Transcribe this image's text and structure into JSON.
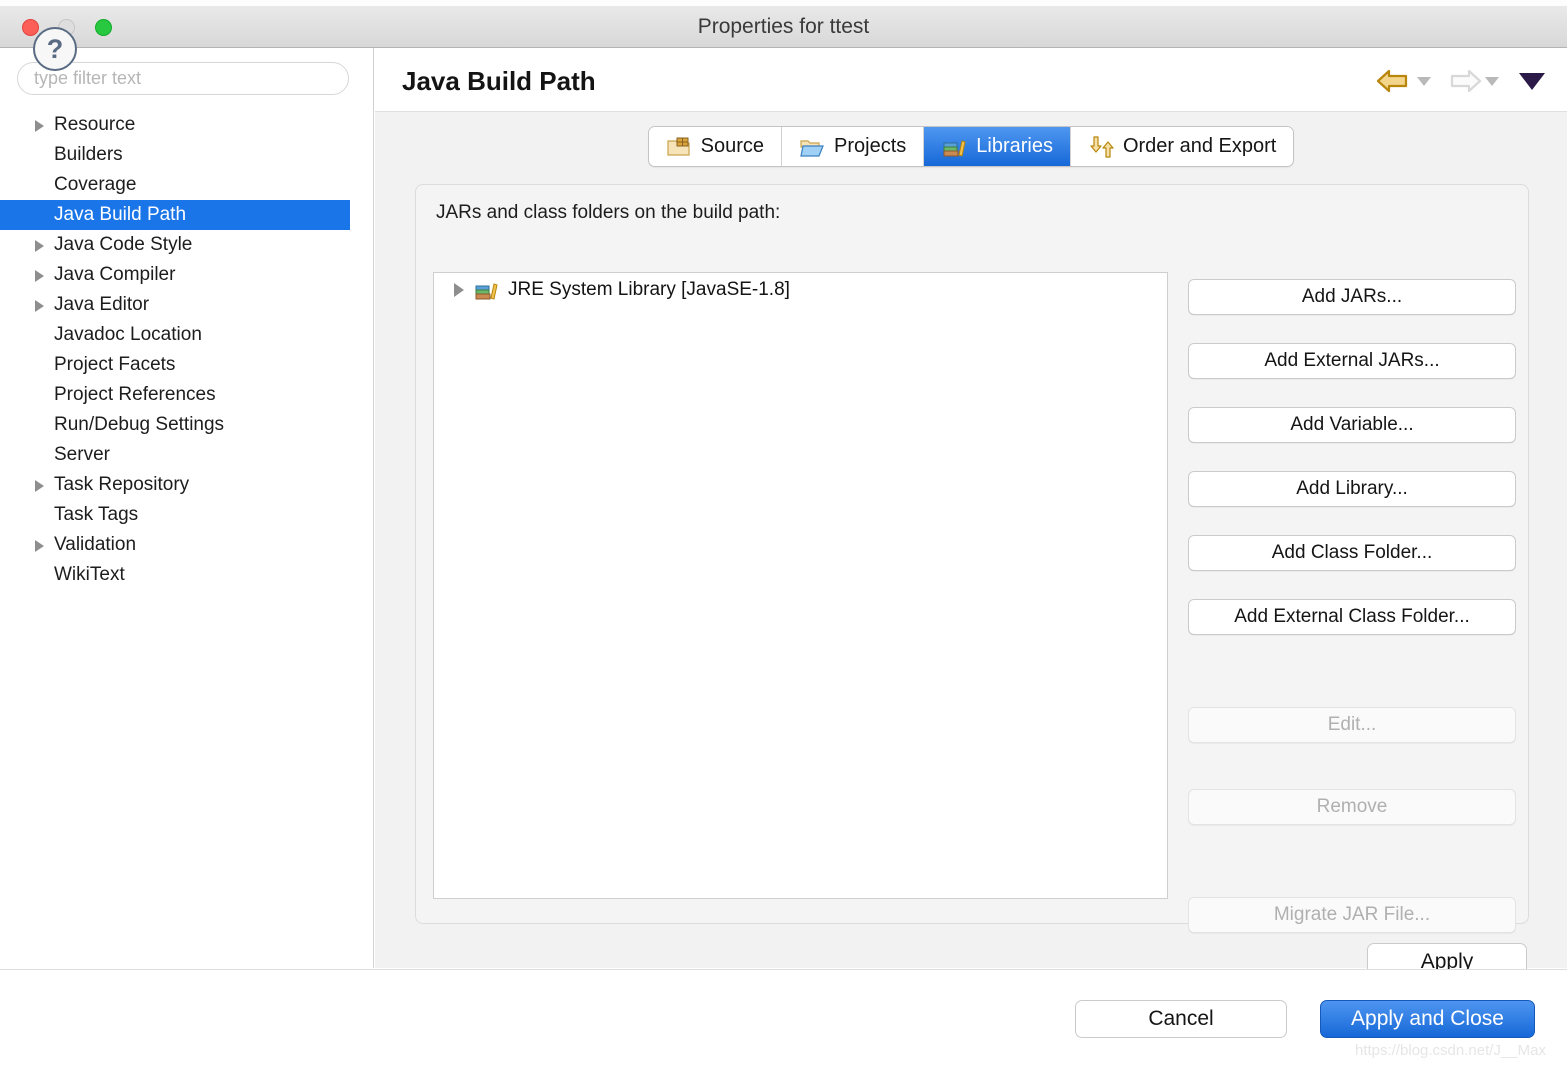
{
  "window": {
    "title": "Properties for ttest",
    "traffic_lights": [
      "close",
      "minimize",
      "maximize"
    ]
  },
  "sidebar": {
    "filter_placeholder": "type filter text",
    "filter_value": "",
    "items": [
      {
        "label": "Resource",
        "expandable": true,
        "selected": false
      },
      {
        "label": "Builders",
        "expandable": false,
        "selected": false
      },
      {
        "label": "Coverage",
        "expandable": false,
        "selected": false
      },
      {
        "label": "Java Build Path",
        "expandable": false,
        "selected": true
      },
      {
        "label": "Java Code Style",
        "expandable": true,
        "selected": false
      },
      {
        "label": "Java Compiler",
        "expandable": true,
        "selected": false
      },
      {
        "label": "Java Editor",
        "expandable": true,
        "selected": false
      },
      {
        "label": "Javadoc Location",
        "expandable": false,
        "selected": false
      },
      {
        "label": "Project Facets",
        "expandable": false,
        "selected": false
      },
      {
        "label": "Project References",
        "expandable": false,
        "selected": false
      },
      {
        "label": "Run/Debug Settings",
        "expandable": false,
        "selected": false
      },
      {
        "label": "Server",
        "expandable": false,
        "selected": false
      },
      {
        "label": "Task Repository",
        "expandable": true,
        "selected": false
      },
      {
        "label": "Task Tags",
        "expandable": false,
        "selected": false
      },
      {
        "label": "Validation",
        "expandable": true,
        "selected": false
      },
      {
        "label": "WikiText",
        "expandable": false,
        "selected": false
      }
    ]
  },
  "header": {
    "page_title": "Java Build Path",
    "back_icon": "back-arrow-icon",
    "back_enabled": true,
    "forward_icon": "forward-arrow-icon",
    "forward_enabled": false,
    "menu_icon": "dropdown-triangle-icon"
  },
  "tabs": [
    {
      "label": "Source",
      "icon": "source-folder-icon",
      "active": false
    },
    {
      "label": "Projects",
      "icon": "project-folder-icon",
      "active": false
    },
    {
      "label": "Libraries",
      "icon": "books-icon",
      "active": true
    },
    {
      "label": "Order and Export",
      "icon": "order-arrows-icon",
      "active": false
    }
  ],
  "panel": {
    "label": "JARs and class folders on the build path:",
    "entries": [
      {
        "label": "JRE System Library [JavaSE-1.8]",
        "icon": "books-icon",
        "expandable": true
      }
    ]
  },
  "side_buttons": [
    {
      "label": "Add JARs...",
      "enabled": true,
      "gap_after": "sm"
    },
    {
      "label": "Add External JARs...",
      "enabled": true,
      "gap_after": "sm"
    },
    {
      "label": "Add Variable...",
      "enabled": true,
      "gap_after": "sm"
    },
    {
      "label": "Add Library...",
      "enabled": true,
      "gap_after": "sm"
    },
    {
      "label": "Add Class Folder...",
      "enabled": true,
      "gap_after": "sm"
    },
    {
      "label": "Add External Class Folder...",
      "enabled": true,
      "gap_after": "lg"
    },
    {
      "label": "Edit...",
      "enabled": false,
      "gap_after": "md"
    },
    {
      "label": "Remove",
      "enabled": false,
      "gap_after": "lg"
    },
    {
      "label": "Migrate JAR File...",
      "enabled": false,
      "gap_after": "sm"
    }
  ],
  "footer": {
    "apply_label": "Apply",
    "help_label": "?",
    "cancel_label": "Cancel",
    "apply_close_label": "Apply and Close",
    "watermark": "https://blog.csdn.net/J__Max"
  },
  "colors": {
    "selection_blue": "#1a76e8",
    "primary_button": "#1668d8",
    "titlebar": "#e1e1e1",
    "panel_bg": "#f2f2f2",
    "traffic_close": "#fc5f57",
    "traffic_min": "#dedede",
    "traffic_max": "#28c840"
  }
}
